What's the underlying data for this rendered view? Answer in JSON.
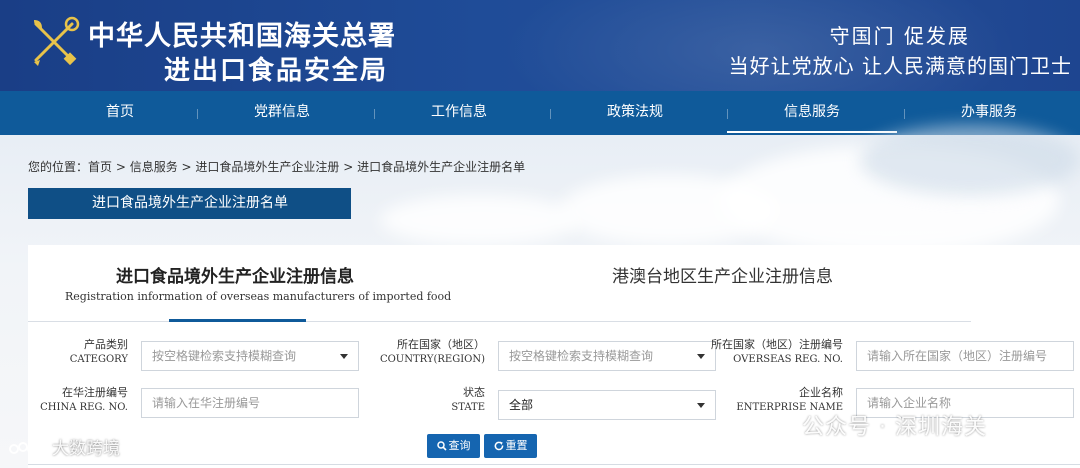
{
  "header": {
    "org_name_line1": "中华人民共和国海关总署",
    "org_name_line2": "进出口食品安全局",
    "slogan_line1": "守国门  促发展",
    "slogan_line2": "当好让党放心  让人民满意的国门卫士"
  },
  "nav": {
    "items": [
      "首页",
      "党群信息",
      "工作信息",
      "政策法规",
      "信息服务",
      "办事服务"
    ],
    "active": "信息服务"
  },
  "breadcrumb": {
    "prefix": "您的位置：",
    "path": "首页 > 信息服务 > 进口食品境外生产企业注册 > 进口食品境外生产企业注册名单"
  },
  "page_tag": "进口食品境外生产企业注册名单",
  "tabs": [
    {
      "title": "进口食品境外生产企业注册信息",
      "subtitle": "Registration information of overseas manufacturers of imported food",
      "active": true
    },
    {
      "title": "港澳台地区生产企业注册信息",
      "active": false
    }
  ],
  "form": {
    "category": {
      "label_cn": "产品类别",
      "label_en": "CATEGORY",
      "placeholder": "按空格键检索支持模糊查询"
    },
    "country": {
      "label_cn": "所在国家（地区）",
      "label_en": "COUNTRY(REGION)",
      "placeholder": "按空格键检索支持模糊查询"
    },
    "overseas_reg": {
      "label_cn": "所在国家（地区）注册编号",
      "label_en": "OVERSEAS REG. NO.",
      "placeholder": "请输入所在国家（地区）注册编号"
    },
    "china_reg": {
      "label_cn": "在华注册编号",
      "label_en": "CHINA REG. NO.",
      "placeholder": "请输入在华注册编号"
    },
    "state": {
      "label_cn": "状态",
      "label_en": "STATE",
      "value": "全部"
    },
    "enterprise": {
      "label_cn": "企业名称",
      "label_en": "ENTERPRISE NAME",
      "placeholder": "请输入企业名称"
    }
  },
  "buttons": {
    "search": "查询",
    "reset": "重置"
  },
  "watermarks": {
    "left": "大数跨境",
    "right": "公众号 · 深圳海关"
  },
  "colors": {
    "header_bg": "#1f4c98",
    "nav_bg": "#0f5a9a",
    "tag_bg": "#0f4f86",
    "button_bg": "#1565b0"
  }
}
